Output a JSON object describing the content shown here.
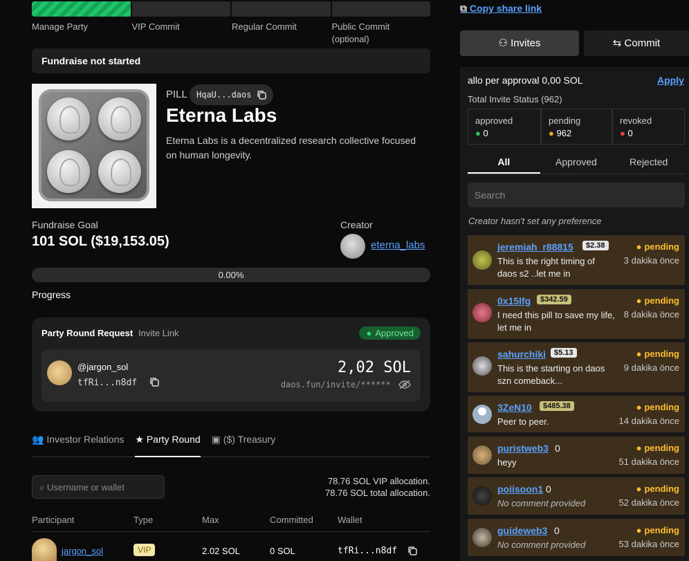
{
  "steps": [
    "Manage Party",
    "VIP Commit",
    "Regular Commit",
    "Public Commit (optional)"
  ],
  "banner": "Fundraise not started",
  "token": {
    "ticker": "PILL",
    "address": "HqaU...daos",
    "name": "Eterna Labs",
    "description": "Eterna Labs is a decentralized research collective focused on human longevity."
  },
  "fundraise": {
    "goal_label": "Fundraise Goal",
    "goal_value": "101 SOL ($19,153.05)",
    "creator_label": "Creator",
    "creator_name": "eterna_labs",
    "progress_text": "0.00%",
    "progress_value": 0.0,
    "progress_label": "Progress"
  },
  "request": {
    "title": "Party Round Request",
    "invite_link_label": "Invite Link",
    "status": "Approved",
    "username": "@jargon_sol",
    "wallet": "tfRi...n8df",
    "amount": "2,02 SOL",
    "link": "daos.fun/invite/******"
  },
  "tabs": [
    "Investor Relations",
    "Party Round",
    "($) Treasury"
  ],
  "table": {
    "search_placeholder": "Username or wallet",
    "vip_alloc": "78.76 SOL VIP allocation.",
    "total_alloc": "78.76 SOL total allocation.",
    "headers": [
      "Participant",
      "Type",
      "Max",
      "Committed",
      "Wallet"
    ],
    "rows": [
      {
        "participant": "jargon_sol",
        "type": "VIP",
        "max": "2.02 SOL",
        "committed": "0 SOL",
        "wallet": "tfRi...n8df"
      }
    ]
  },
  "right": {
    "share_link": "Copy share link",
    "invites_btn": "Invites",
    "commit_btn": "Commit",
    "allo_text": "allo per approval 0,00 SOL",
    "apply": "Apply",
    "total_status": "Total Invite Status (962)",
    "stats": [
      {
        "label": "approved",
        "value": "0",
        "color": "#2fc463"
      },
      {
        "label": "pending",
        "value": "962",
        "color": "#f4b21e"
      },
      {
        "label": "revoked",
        "value": "0",
        "color": "#e5473d"
      }
    ],
    "filter_tabs": [
      "All",
      "Approved",
      "Rejected"
    ],
    "search_placeholder": "Search",
    "pref": "Creator hasn't set any preference",
    "items": [
      {
        "name": "jeremiah_r88815",
        "badge": "$2.38",
        "badge_color": "#e6e6e6",
        "status": "pending",
        "msg": "This is the right timing of daos s2 ..let me in",
        "time": "3 dakika önce"
      },
      {
        "name": "0x15lfg",
        "badge": "$342.59",
        "badge_color": "#c9c07a",
        "status": "pending",
        "msg": "I need this pill to save my life, let me in",
        "time": "8 dakika önce"
      },
      {
        "name": "sahurchiki",
        "badge": "$5.13",
        "badge_color": "#e6e6e6",
        "status": "pending",
        "msg": "This is the starting on daos szn comeback...",
        "time": "9 dakika önce"
      },
      {
        "name": "3ZeN10",
        "badge": "$485.38",
        "badge_color": "#c9c07a",
        "status": "pending",
        "msg": "Peer to peer.",
        "time": "14 dakika önce"
      },
      {
        "name": "puristweb3",
        "zero": "0",
        "status": "pending",
        "msg": "heyy",
        "time": "51 dakika önce"
      },
      {
        "name": "poiisoon1",
        "zero": "0",
        "status": "pending",
        "msg": "No comment provided",
        "time": "52 dakika önce"
      },
      {
        "name": "guideweb3",
        "zero": "0",
        "status": "pending",
        "msg": "No comment provided",
        "time": "53 dakika önce"
      }
    ]
  }
}
